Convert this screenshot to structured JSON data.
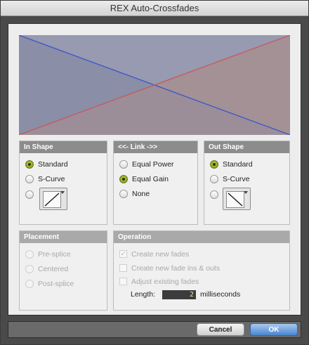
{
  "window": {
    "title": "REX Auto-Crossfades"
  },
  "preview": {
    "fade_in_color": "#c9585a",
    "fade_out_color": "#3b55c9"
  },
  "in_shape": {
    "header": "In Shape",
    "options": [
      {
        "label": "Standard",
        "selected": true
      },
      {
        "label": "S-Curve",
        "selected": false
      }
    ],
    "custom_selected": false
  },
  "link": {
    "header": "<<- Link ->>",
    "options": [
      {
        "label": "Equal Power",
        "selected": false
      },
      {
        "label": "Equal Gain",
        "selected": true
      },
      {
        "label": "None",
        "selected": false
      }
    ]
  },
  "out_shape": {
    "header": "Out Shape",
    "options": [
      {
        "label": "Standard",
        "selected": true
      },
      {
        "label": "S-Curve",
        "selected": false
      }
    ],
    "custom_selected": false
  },
  "placement": {
    "header": "Placement",
    "options": [
      {
        "label": "Pre-splice"
      },
      {
        "label": "Centered"
      },
      {
        "label": "Post-splice"
      }
    ]
  },
  "operation": {
    "header": "Operation",
    "checks": [
      {
        "label": "Create new fades",
        "checked": true
      },
      {
        "label": "Create new fade ins & outs",
        "checked": false
      },
      {
        "label": "Adjust existing fades",
        "checked": false
      }
    ],
    "length_label": "Length:",
    "length_value": "2",
    "length_units": "milliseconds"
  },
  "buttons": {
    "cancel": "Cancel",
    "ok": "OK"
  }
}
